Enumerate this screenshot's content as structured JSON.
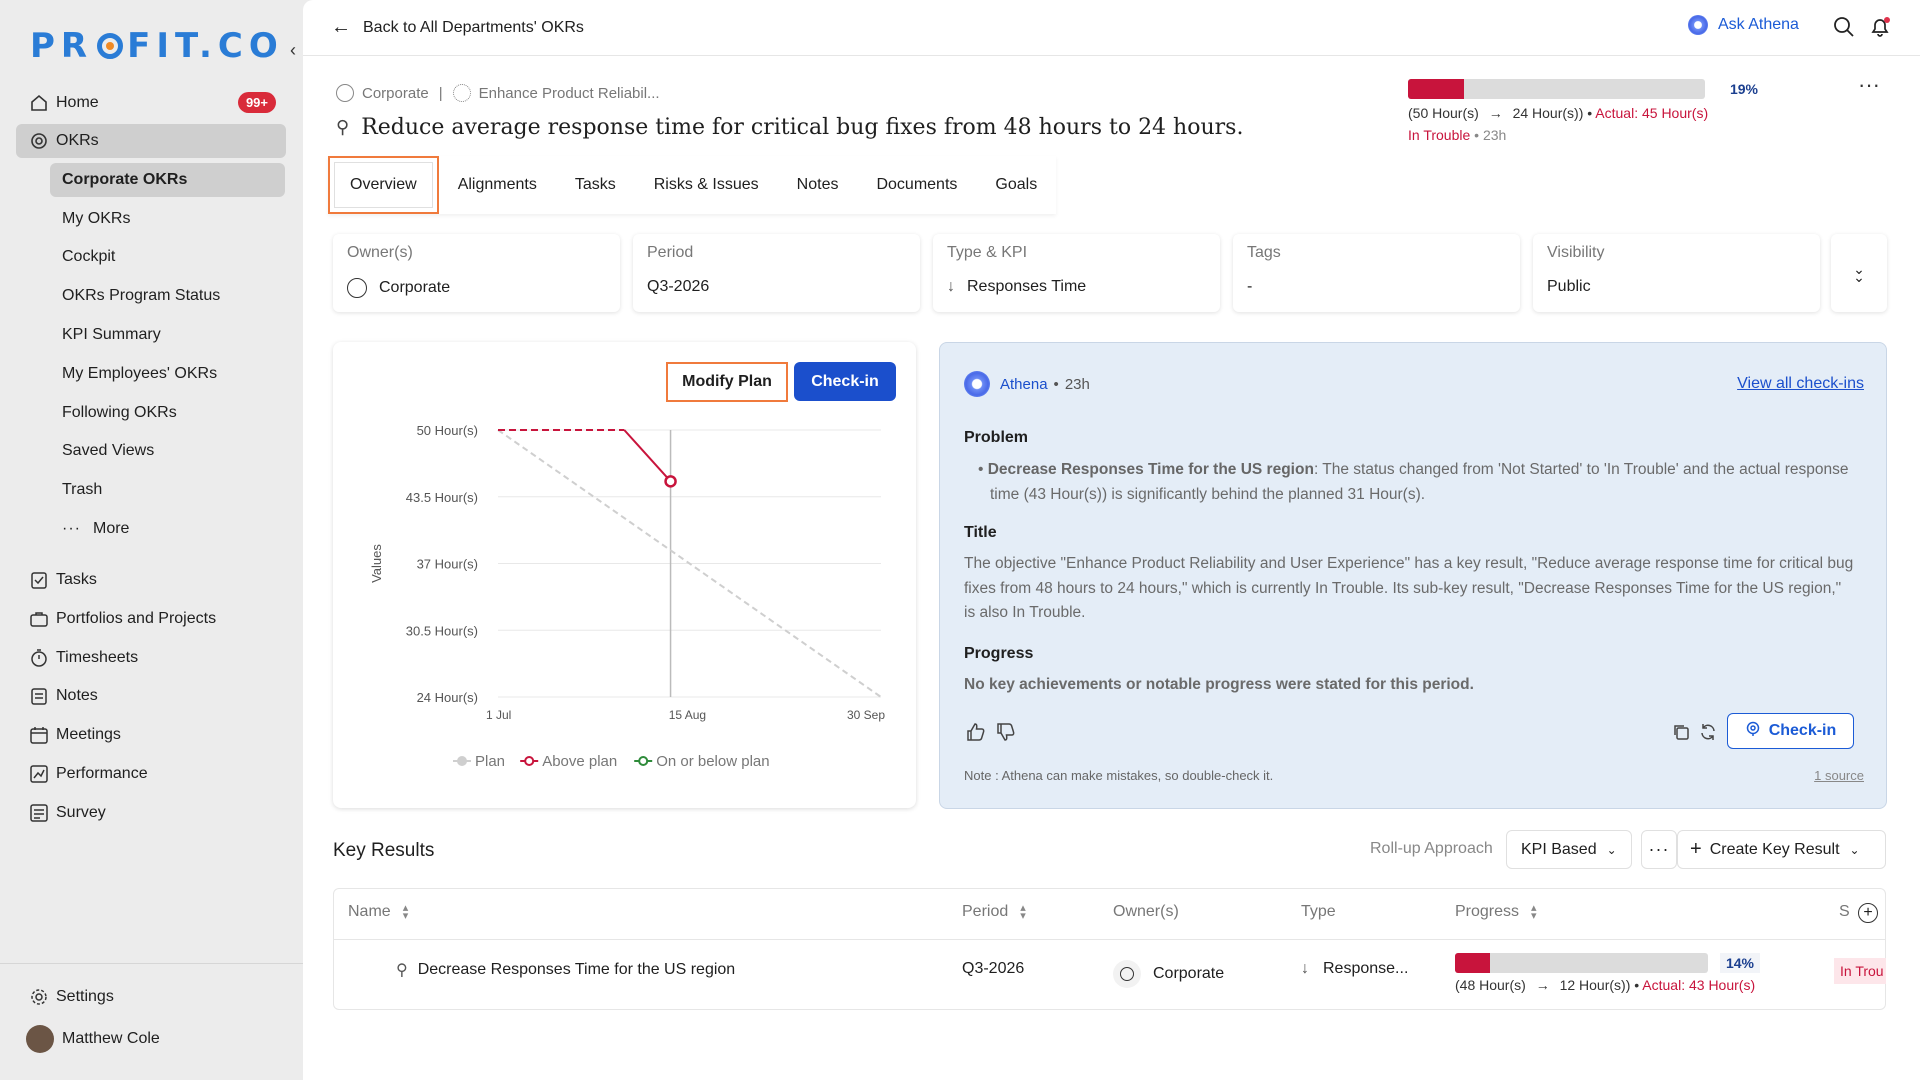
{
  "brand": {
    "logo_pre": "PR",
    "logo_post": "FIT.CO"
  },
  "sidebar": {
    "home": {
      "label": "Home",
      "badge": "99+"
    },
    "okrs": {
      "label": "OKRs"
    },
    "okr_sub": [
      "Corporate OKRs",
      "My OKRs",
      "Cockpit",
      "OKRs Program Status",
      "KPI Summary",
      "My Employees' OKRs",
      "Following OKRs",
      "Saved Views",
      "Trash",
      "More"
    ],
    "modules": [
      "Tasks",
      "Portfolios and Projects",
      "Timesheets",
      "Notes",
      "Meetings",
      "Performance",
      "Survey"
    ],
    "settings": "Settings",
    "user": "Matthew Cole"
  },
  "topbar": {
    "back": "Back to All Departments' OKRs",
    "ask": "Ask Athena"
  },
  "header": {
    "crumb_1": "Corporate",
    "crumb_sep": "|",
    "crumb_2": "Enhance Product Reliabil...",
    "title": "Reduce average response time for critical bug fixes from 48 hours to 24 hours.",
    "progress_pct": "19%",
    "progress_fraction": 0.19,
    "progress_from": "(50 Hour(s)",
    "progress_to": "24 Hour(s))",
    "progress_actual": "Actual: 45 Hour(s)",
    "status": "In Trouble",
    "status_time": "23h"
  },
  "tabs": [
    "Overview",
    "Alignments",
    "Tasks",
    "Risks & Issues",
    "Notes",
    "Documents",
    "Goals"
  ],
  "meta": {
    "owner_label": "Owner(s)",
    "owner": "Corporate",
    "period_label": "Period",
    "period": "Q3-2026",
    "type_label": "Type & KPI",
    "type": "Responses Time",
    "tags_label": "Tags",
    "tags": "-",
    "vis_label": "Visibility",
    "vis": "Public"
  },
  "chart_buttons": {
    "modify": "Modify Plan",
    "checkin": "Check-in"
  },
  "chart_data": {
    "type": "line",
    "ylabel": "Values",
    "yticks": [
      "50 Hour(s)",
      "43.5 Hour(s)",
      "37 Hour(s)",
      "30.5 Hour(s)",
      "24 Hour(s)"
    ],
    "ylim": [
      24,
      50
    ],
    "xticks": [
      "1 Jul",
      "15 Aug",
      "30 Sep"
    ],
    "x_days": [
      0,
      45,
      91
    ],
    "series": [
      {
        "name": "Plan",
        "color": "#cfcfcf",
        "points": [
          [
            0,
            50
          ],
          [
            91,
            24
          ]
        ]
      },
      {
        "name": "Above plan",
        "color": "#c8143c",
        "points": [
          [
            0,
            50
          ],
          [
            30,
            50
          ],
          [
            41,
            45
          ]
        ]
      },
      {
        "name": "On or below plan",
        "color": "#2e8b3a",
        "points": []
      }
    ],
    "current_x": 41
  },
  "athena": {
    "name": "Athena",
    "time": "23h",
    "view_all": "View all check-ins",
    "problem_h": "Problem",
    "problem_bold": "Decrease Responses Time for the US region",
    "problem_text": ": The status changed from 'Not Started' to 'In Trouble' and the actual response time (43 Hour(s)) is significantly behind the planned 31 Hour(s).",
    "title_h": "Title",
    "title_text": "The objective \"Enhance Product Reliability and User Experience\" has a key result, \"Reduce average response time for critical bug fixes from 48 hours to 24 hours,\" which is currently In Trouble. Its sub-key result, \"Decrease Responses Time for the US region,\" is also In Trouble.",
    "progress_h": "Progress",
    "progress_text": "No key achievements or notable progress were stated for this period.",
    "checkin": "Check-in",
    "note": "Note : Athena can make mistakes, so double-check it.",
    "source": "1 source"
  },
  "key_results": {
    "title": "Key Results",
    "rollup_label": "Roll-up Approach",
    "rollup_value": "KPI Based",
    "create": "Create Key Result",
    "cols": [
      "Name",
      "Period",
      "Owner(s)",
      "Type",
      "Progress",
      "S"
    ],
    "row": {
      "name": "Decrease Responses Time for the US region",
      "period": "Q3-2026",
      "owner": "Corporate",
      "type": "Response...",
      "pct": "14%",
      "pct_fraction": 0.14,
      "from": "(48 Hour(s)",
      "to": "12 Hour(s))",
      "actual": "Actual: 43 Hour(s)",
      "status": "In Trou"
    }
  }
}
